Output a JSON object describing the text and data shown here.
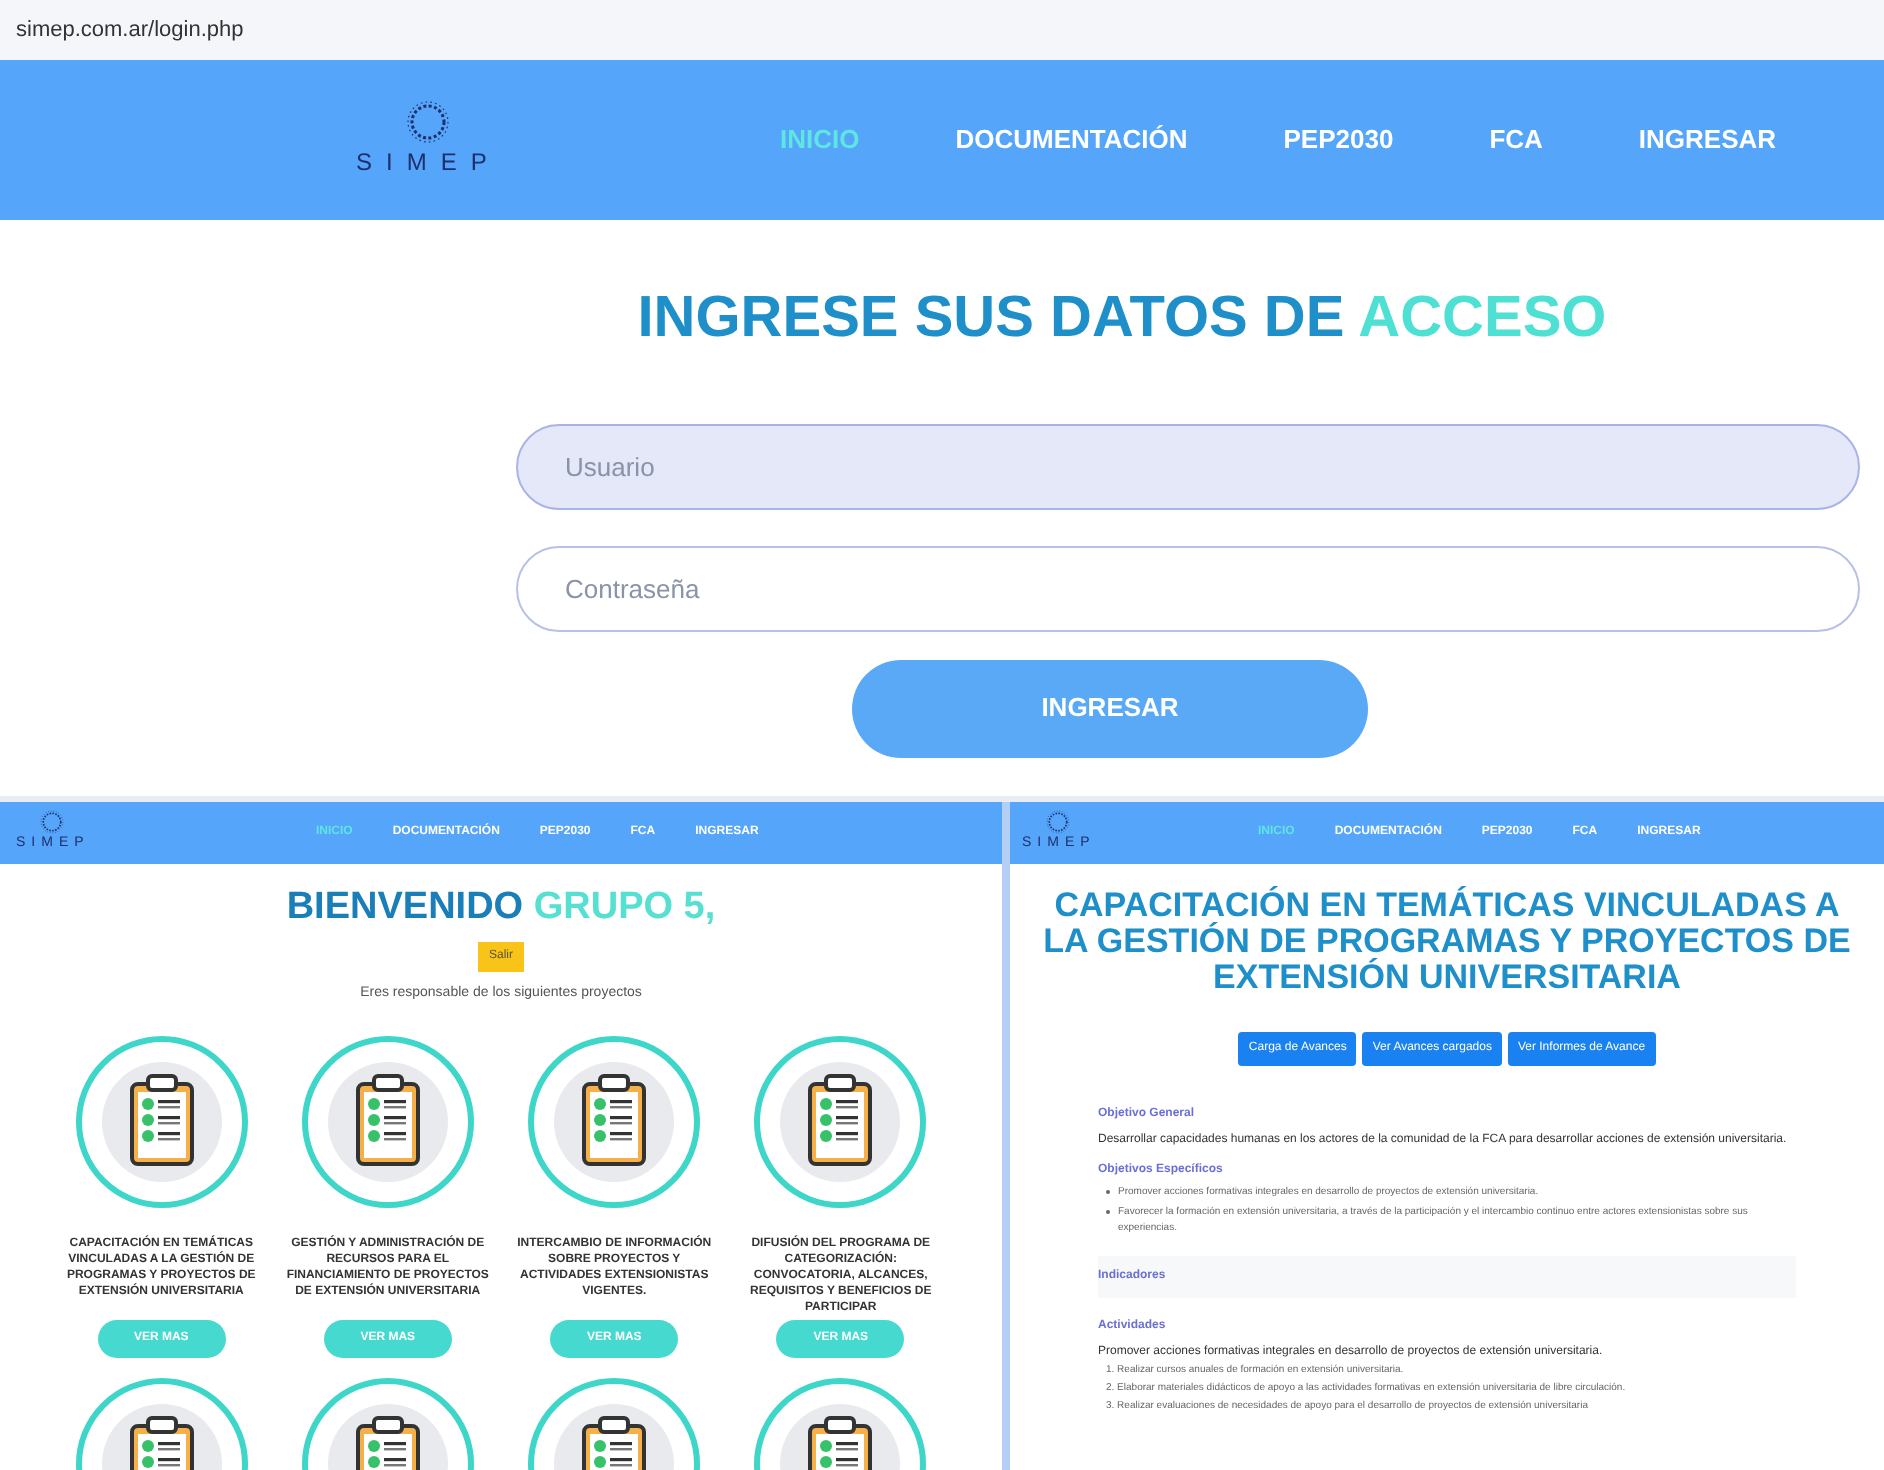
{
  "url": "simep.com.ar/login.php",
  "header": {
    "logo_text": "SIMEP",
    "nav": [
      {
        "label": "INICIO",
        "selected": true
      },
      {
        "label": "DOCUMENTACIÓN",
        "selected": false
      },
      {
        "label": "PEP2030",
        "selected": false
      },
      {
        "label": "FCA",
        "selected": false
      },
      {
        "label": "INGRESAR",
        "selected": false
      }
    ]
  },
  "login": {
    "title": "INGRESE SUS DATOS DE",
    "title_highlight": "ACCESO",
    "fields": [
      {
        "placeholder": "Usuario",
        "highlighted": true
      },
      {
        "placeholder": "Contraseña",
        "highlighted": false
      }
    ],
    "button": "INGRESAR"
  },
  "dashboard": {
    "logo_text": "SIMEP",
    "nav": [
      {
        "label": "INICIO",
        "selected": true
      },
      {
        "label": "DOCUMENTACIÓN",
        "selected": false
      },
      {
        "label": "PEP2030",
        "selected": false
      },
      {
        "label": "FCA",
        "selected": false
      },
      {
        "label": "INGRESAR",
        "selected": false
      }
    ],
    "title": "BIENVENIDO",
    "title_highlight": "GRUPO 5,",
    "logout_button": "Salir",
    "subtitle": "Eres responsable de los siguientes proyectos",
    "projects": [
      {
        "title": "CAPACITACIÓN EN TEMÁTICAS VINCULADAS A LA GESTIÓN DE PROGRAMAS Y PROYECTOS DE EXTENSIÓN UNIVERSITARIA",
        "button": "VER MAS"
      },
      {
        "title": "GESTIÓN Y ADMINISTRACIÓN DE RECURSOS PARA EL FINANCIAMIENTO DE PROYECTOS DE EXTENSIÓN UNIVERSITARIA",
        "button": "VER MAS"
      },
      {
        "title": "INTERCAMBIO DE INFORMACIÓN SOBRE PROYECTOS Y ACTIVIDADES EXTENSIONISTAS VIGENTES.",
        "button": "VER MAS"
      },
      {
        "title": "DIFUSIÓN DEL PROGRAMA DE CATEGORIZACIÓN: CONVOCATORIA, ALCANCES, REQUISITOS Y BENEFICIOS DE PARTICIPAR",
        "button": "VER MAS"
      }
    ]
  },
  "project_page": {
    "logo_text": "SIMEP",
    "nav": [
      {
        "label": "INICIO",
        "selected": true
      },
      {
        "label": "DOCUMENTACIÓN",
        "selected": false
      },
      {
        "label": "PEP2030",
        "selected": false
      },
      {
        "label": "FCA",
        "selected": false
      },
      {
        "label": "INGRESAR",
        "selected": false
      }
    ],
    "title": "CAPACITACIÓN EN TEMÁTICAS VINCULADAS A LA GESTIÓN DE PROGRAMAS Y PROYECTOS DE EXTENSIÓN UNIVERSITARIA",
    "buttons": [
      "Carga de Avances",
      "Ver Avances cargados",
      "Ver Informes de Avance"
    ],
    "sections": [
      {
        "heading": "Objetivo General",
        "paragraph": "Desarrollar capacidades humanas en los actores de la comunidad de la FCA para desarrollar acciones de extensión universitaria."
      },
      {
        "heading": "Objetivos Específicos",
        "bullets": [
          "Promover acciones formativas integrales en desarrollo de proyectos de extensión universitaria.",
          "Favorecer la formación en extensión universitaria, a través de la participación y el intercambio continuo entre actores extensionistas sobre sus experiencias."
        ]
      },
      {
        "heading": "Indicadores",
        "boxed": true
      },
      {
        "heading": "Actividades",
        "paragraph": "Promover acciones formativas integrales en desarrollo de proyectos de extensión universitaria.",
        "numbered": [
          "1. Realizar cursos anuales de formación en extensión universitaria.",
          "2. Elaborar materiales didácticos de apoyo a las actividades formativas en extensión universitaria de libre circulación.",
          "3. Realizar evaluaciones de necesidades de apoyo para el desarrollo de proyectos de extensión universitaria"
        ]
      }
    ]
  }
}
